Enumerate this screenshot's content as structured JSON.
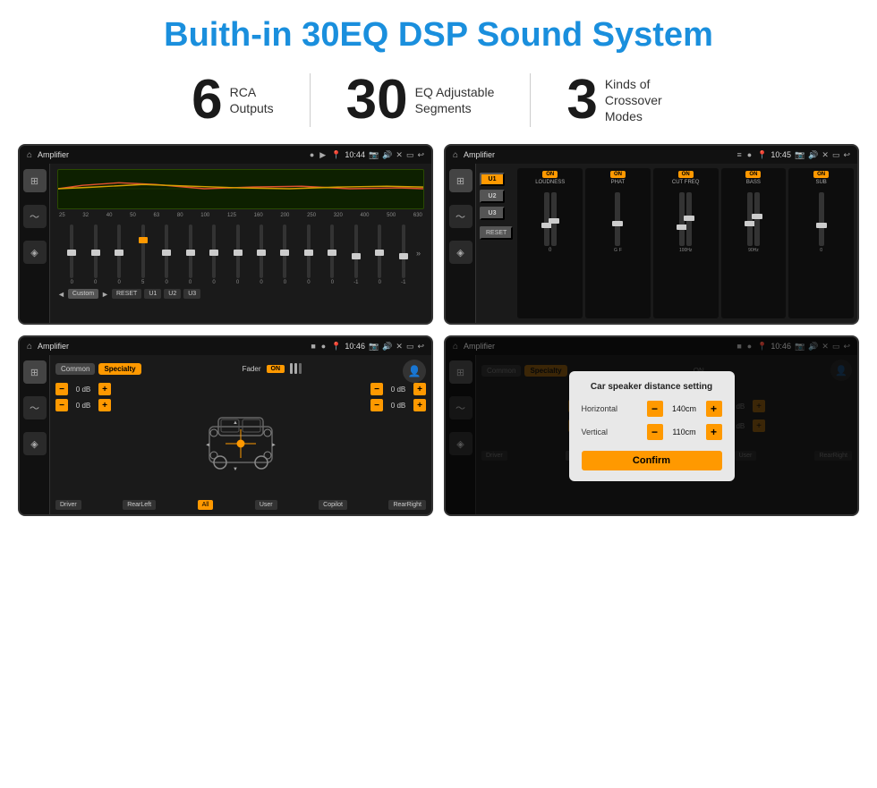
{
  "header": {
    "title": "Buith-in 30EQ DSP Sound System"
  },
  "stats": [
    {
      "number": "6",
      "label": "RCA\nOutputs"
    },
    {
      "number": "30",
      "label": "EQ Adjustable\nSegments"
    },
    {
      "number": "3",
      "label": "Kinds of\nCrossover Modes"
    }
  ],
  "screens": [
    {
      "id": "screen1",
      "status_bar": {
        "app": "Amplifier",
        "time": "10:44"
      },
      "type": "eq"
    },
    {
      "id": "screen2",
      "status_bar": {
        "app": "Amplifier",
        "time": "10:45"
      },
      "type": "amp2"
    },
    {
      "id": "screen3",
      "status_bar": {
        "app": "Amplifier",
        "time": "10:46"
      },
      "type": "crossover"
    },
    {
      "id": "screen4",
      "status_bar": {
        "app": "Amplifier",
        "time": "10:46"
      },
      "type": "dialog",
      "dialog": {
        "title": "Car speaker distance setting",
        "horizontal_label": "Horizontal",
        "horizontal_value": "140cm",
        "vertical_label": "Vertical",
        "vertical_value": "110cm",
        "confirm_label": "Confirm"
      }
    }
  ],
  "eq_freqs": [
    "25",
    "32",
    "40",
    "50",
    "63",
    "80",
    "100",
    "125",
    "160",
    "200",
    "250",
    "320",
    "400",
    "500",
    "630"
  ],
  "eq_vals": [
    "0",
    "0",
    "0",
    "5",
    "0",
    "0",
    "0",
    "0",
    "0",
    "0",
    "0",
    "0",
    "-1",
    "0",
    "-1"
  ],
  "eq_buttons": [
    "Custom",
    "RESET",
    "U1",
    "U2",
    "U3"
  ],
  "amp2_channels": [
    {
      "label": "U1",
      "active": true
    },
    {
      "label": "U2",
      "active": false
    },
    {
      "label": "U3",
      "active": false
    }
  ],
  "amp2_panels": [
    {
      "name": "LOUDNESS",
      "on": true
    },
    {
      "name": "PHAT",
      "on": true
    },
    {
      "name": "CUT FREQ",
      "on": true
    },
    {
      "name": "BASS",
      "on": true
    },
    {
      "name": "SUB",
      "on": true
    }
  ],
  "crossover": {
    "tabs": [
      "Common",
      "Specialty"
    ],
    "active_tab": "Specialty",
    "fader_label": "Fader",
    "on_label": "ON",
    "db_rows": [
      {
        "value": "0 dB"
      },
      {
        "value": "0 dB"
      },
      {
        "value": "0 dB"
      },
      {
        "value": "0 dB"
      }
    ],
    "bottom_labels": [
      "Driver",
      "RearLeft",
      "All",
      "User",
      "Copilot",
      "RearRight"
    ]
  }
}
